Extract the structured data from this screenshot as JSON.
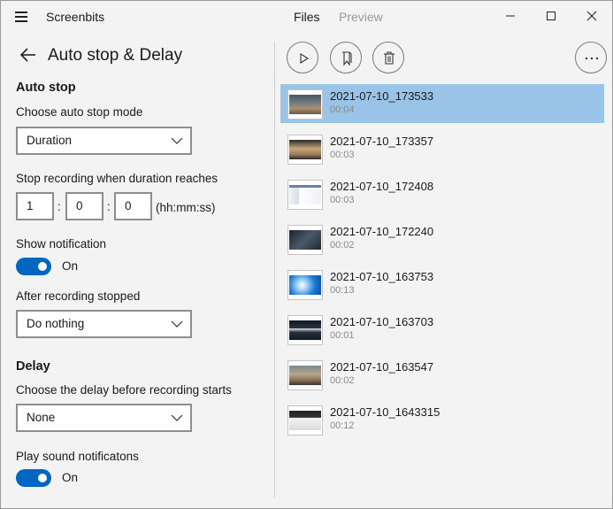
{
  "app": {
    "title": "Screenbits"
  },
  "nav": {
    "files": "Files",
    "preview": "Preview"
  },
  "panel": {
    "title": "Auto stop & Delay",
    "auto_stop": {
      "heading": "Auto stop",
      "mode_label": "Choose auto stop mode",
      "mode_value": "Duration",
      "duration_label": "Stop recording when duration reaches",
      "hours": "1",
      "minutes": "0",
      "seconds": "0",
      "separator": ":",
      "unit": "(hh:mm:ss)",
      "notification_label": "Show notification",
      "notification_state": "On",
      "after_label": "After recording stopped",
      "after_value": "Do nothing"
    },
    "delay": {
      "heading": "Delay",
      "delay_label": "Choose the delay before recording starts",
      "delay_value": "None",
      "sound_label": "Play sound notificatons",
      "sound_state": "On"
    }
  },
  "colors": {
    "accent": "#0067c0",
    "selection": "#99c4e8"
  },
  "toolbar": {
    "icons": [
      "play-icon",
      "bookmark-icon",
      "delete-icon",
      "more-icon"
    ]
  },
  "files": [
    {
      "name": "2021-07-10_173533",
      "duration": "00:04",
      "selected": true
    },
    {
      "name": "2021-07-10_173357",
      "duration": "00:03"
    },
    {
      "name": "2021-07-10_172408",
      "duration": "00:03"
    },
    {
      "name": "2021-07-10_172240",
      "duration": "00:02"
    },
    {
      "name": "2021-07-10_163753",
      "duration": "00:13"
    },
    {
      "name": "2021-07-10_163703",
      "duration": "00:01"
    },
    {
      "name": "2021-07-10_163547",
      "duration": "00:02"
    },
    {
      "name": "2021-07-10_1643315",
      "duration": "00:12"
    }
  ]
}
